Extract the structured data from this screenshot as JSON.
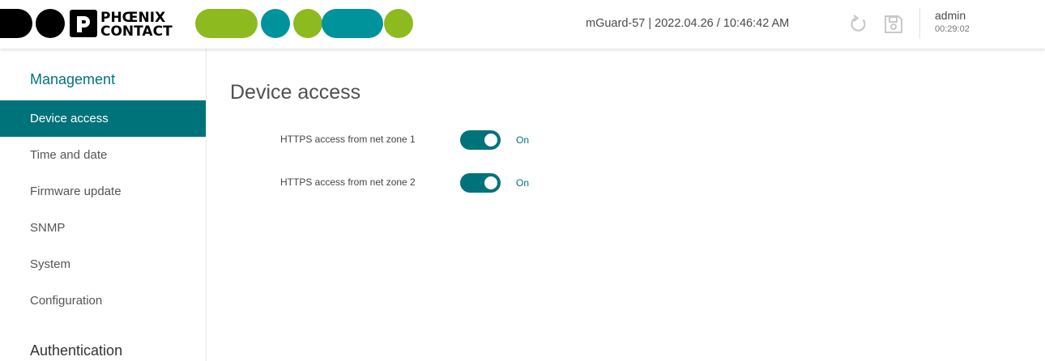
{
  "brand": {
    "logo_text_line1": "PHŒNIX",
    "logo_text_line2": "CONTACT"
  },
  "colors": {
    "accent": "#00737a",
    "logo_green": "#8dba1f",
    "logo_teal": "#00939b",
    "logo_black": "#000000"
  },
  "header": {
    "status": "mGuard-57 | 2022.04.26 / 10:46:42 AM",
    "user": "admin",
    "session_time": "00:29:02",
    "icons": [
      "refresh-icon",
      "save-icon"
    ]
  },
  "sidebar": {
    "section_management": "Management",
    "items": [
      {
        "label": "Device access",
        "active": true
      },
      {
        "label": "Time and date",
        "active": false
      },
      {
        "label": "Firmware update",
        "active": false
      },
      {
        "label": "SNMP",
        "active": false
      },
      {
        "label": "System",
        "active": false
      },
      {
        "label": "Configuration",
        "active": false
      }
    ],
    "section_authentication": "Authentication"
  },
  "main": {
    "title": "Device access",
    "settings": [
      {
        "label": "HTTPS access from net zone 1",
        "state": "On",
        "enabled": true
      },
      {
        "label": "HTTPS access from net zone 2",
        "state": "On",
        "enabled": true
      }
    ]
  }
}
